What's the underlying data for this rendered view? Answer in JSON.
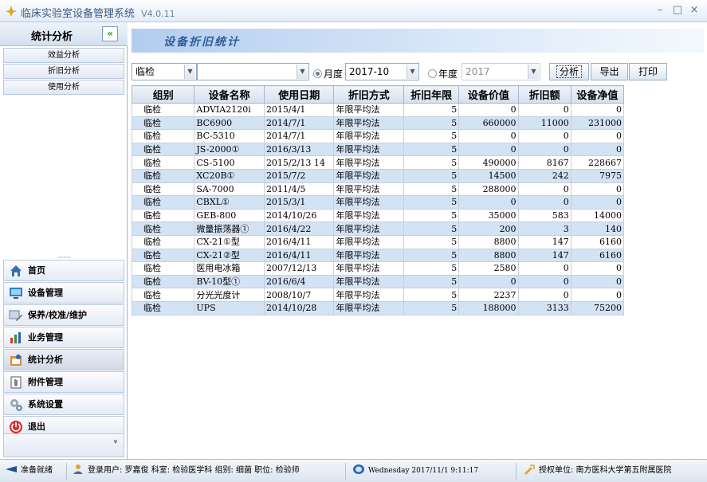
{
  "window": {
    "title": "临床实验室设备管理系统",
    "version": "V4.0.11",
    "controls": {
      "minimize": "–",
      "maximize": "□",
      "close": "×"
    }
  },
  "sidebar": {
    "header": "统计分析",
    "collapse_icon": "«",
    "sub_items": [
      {
        "label": "效益分析"
      },
      {
        "label": "折旧分析"
      },
      {
        "label": "使用分析"
      }
    ],
    "dots": "·········",
    "nav": [
      {
        "label": "首页",
        "icon": "home-icon"
      },
      {
        "label": "设备管理",
        "icon": "monitor-icon"
      },
      {
        "label": "保养/校准/维护",
        "icon": "tools-icon"
      },
      {
        "label": "业务管理",
        "icon": "bar-chart-icon"
      },
      {
        "label": "统计分析",
        "icon": "analytics-icon"
      },
      {
        "label": "附件管理",
        "icon": "attachment-icon"
      },
      {
        "label": "系统设置",
        "icon": "settings-icon"
      },
      {
        "label": "退出",
        "icon": "power-icon"
      }
    ],
    "more_icon": "»"
  },
  "main": {
    "banner_title": "设备折旧统计",
    "filters": {
      "group_value": "临检",
      "device_value": "",
      "month_label": "月度",
      "month_value": "2017-10",
      "year_label": "年度",
      "year_value": "2017",
      "month_selected": true
    },
    "buttons": {
      "analyze": "分析",
      "export": "导出",
      "print": "打印"
    },
    "table": {
      "columns": [
        "组别",
        "设备名称",
        "使用日期",
        "折旧方式",
        "折旧年限",
        "设备价值",
        "折旧额",
        "设备净值"
      ],
      "rows": [
        [
          "临检",
          "ADVIA2120i",
          "2015/4/1",
          "年限平均法",
          "5",
          "0",
          "0",
          "0"
        ],
        [
          "临检",
          "BC6900",
          "2014/7/1",
          "年限平均法",
          "5",
          "660000",
          "11000",
          "231000"
        ],
        [
          "临检",
          "BC-5310",
          "2014/7/1",
          "年限平均法",
          "5",
          "0",
          "0",
          "0"
        ],
        [
          "临检",
          "JS-2000①",
          "2016/3/13",
          "年限平均法",
          "5",
          "0",
          "0",
          "0"
        ],
        [
          "临检",
          "CS-5100",
          "2015/2/13 14",
          "年限平均法",
          "5",
          "490000",
          "8167",
          "228667"
        ],
        [
          "临检",
          "XC20B①",
          "2015/7/2",
          "年限平均法",
          "5",
          "14500",
          "242",
          "7975"
        ],
        [
          "临检",
          "SA-7000",
          "2011/4/5",
          "年限平均法",
          "5",
          "288000",
          "0",
          "0"
        ],
        [
          "临检",
          "CBXL①",
          "2015/3/1",
          "年限平均法",
          "5",
          "0",
          "0",
          "0"
        ],
        [
          "临检",
          "GEB-800",
          "2014/10/26",
          "年限平均法",
          "5",
          "35000",
          "583",
          "14000"
        ],
        [
          "临检",
          "微量振荡器①",
          "2016/4/22",
          "年限平均法",
          "5",
          "200",
          "3",
          "140"
        ],
        [
          "临检",
          "CX-21①型",
          "2016/4/11",
          "年限平均法",
          "5",
          "8800",
          "147",
          "6160"
        ],
        [
          "临检",
          "CX-21②型",
          "2016/4/11",
          "年限平均法",
          "5",
          "8800",
          "147",
          "6160"
        ],
        [
          "临检",
          "医用电冰箱",
          "2007/12/13",
          "年限平均法",
          "5",
          "2580",
          "0",
          "0"
        ],
        [
          "临检",
          "BV-10型①",
          "2016/6/4",
          "年限平均法",
          "5",
          "0",
          "0",
          "0"
        ],
        [
          "临检",
          "分光光度计",
          "2008/10/7",
          "年限平均法",
          "5",
          "2237",
          "0",
          "0"
        ],
        [
          "临检",
          "UPS",
          "2014/10/28",
          "年限平均法",
          "5",
          "188000",
          "3133",
          "75200"
        ]
      ]
    }
  },
  "statusbar": {
    "ready": "准备就绪",
    "user": "登录用户: 罗嘉俊   科室: 检验医学科   组别: 细菌   职位: 检验师",
    "datetime": "Wednesday 2017/11/1 9:11:17",
    "license": "授权单位: 南方医科大学第五附属医院"
  }
}
